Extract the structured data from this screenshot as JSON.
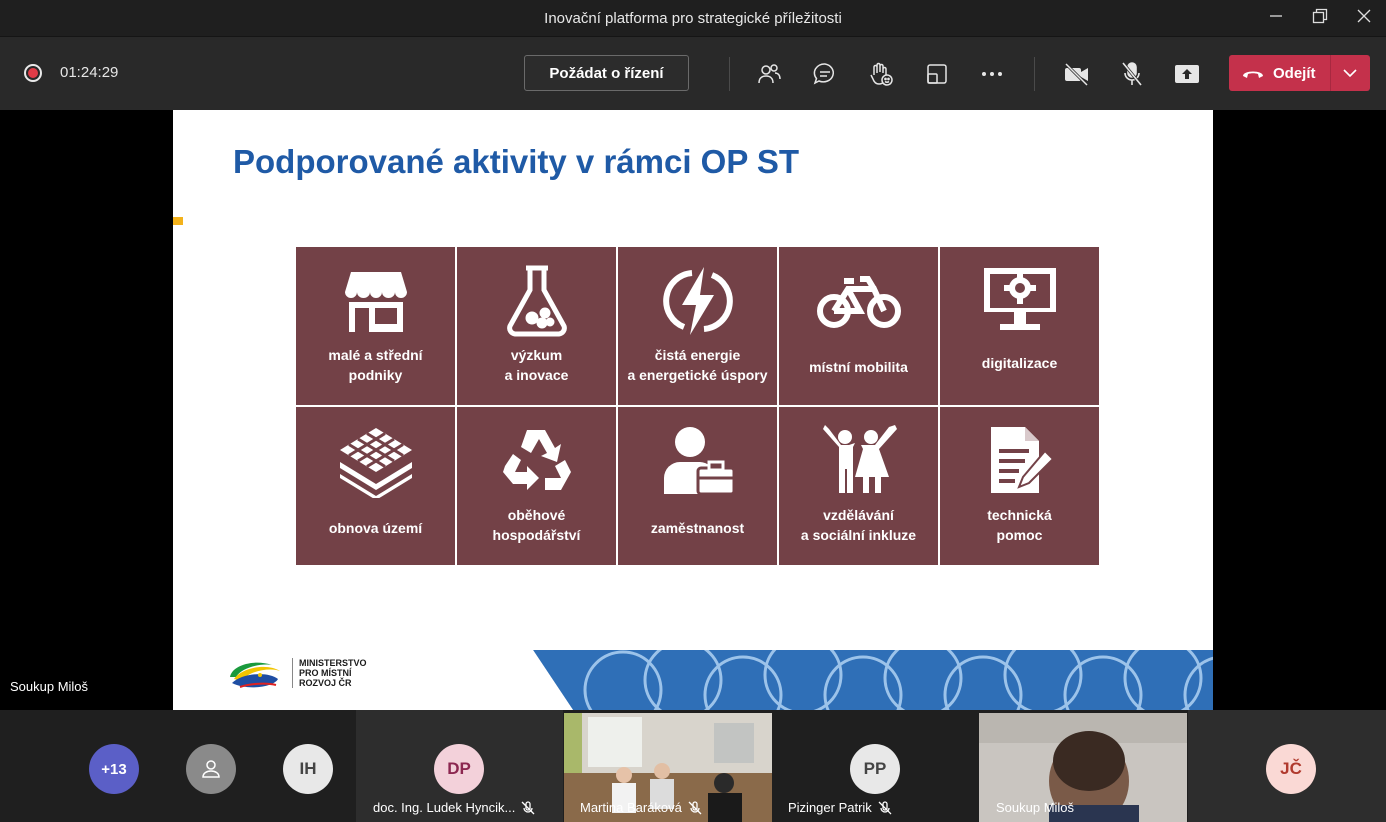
{
  "window": {
    "title": "Inovační platforma pro strategické příležitosti"
  },
  "toolbar": {
    "timer": "01:24:29",
    "request_control_label": "Požádat o řízení",
    "leave_label": "Odejít",
    "icons": [
      "participants-icon",
      "chat-icon",
      "raise-hand-icon",
      "rooms-icon",
      "more-icon",
      "camera-off-icon",
      "mic-off-icon",
      "share-icon"
    ]
  },
  "slide": {
    "title": "Podporované aktivity v rámci OP ST",
    "tiles": [
      {
        "label": "malé a střední\npodniky",
        "icon": "shop-icon"
      },
      {
        "label": "výzkum\na inovace",
        "icon": "flask-icon"
      },
      {
        "label": "čistá energie\na energetické úspory",
        "icon": "energy-icon"
      },
      {
        "label": "místní mobilita",
        "icon": "bicycle-icon"
      },
      {
        "label": "digitalizace",
        "icon": "monitor-gear-icon"
      },
      {
        "label": "obnova území",
        "icon": "layers-icon"
      },
      {
        "label": "oběhové\nhospodářství",
        "icon": "recycle-icon"
      },
      {
        "label": "zaměstnanost",
        "icon": "worker-briefcase-icon"
      },
      {
        "label": "vzdělávání\na sociální inkluze",
        "icon": "people-cheering-icon"
      },
      {
        "label": "technická\npomoc",
        "icon": "document-pen-icon"
      }
    ],
    "logo_text": "MINISTERSTVO\nPRO MÍSTNÍ\nROZVOJ ČR"
  },
  "speaker_name": "Soukup Miloš",
  "participants": {
    "overflow": "+13",
    "ih": "IH",
    "dp_initials": "DP",
    "dp_name": "doc. Ing. Ludek Hyncik...",
    "video1_name": "Martina Baráková",
    "pp_initials": "PP",
    "pp_name": "Pizinger Patrik",
    "video2_name": "Soukup Miloš",
    "jc": "JČ"
  },
  "colors": {
    "accent_red": "#c4314b",
    "tile": "#734147",
    "title_blue": "#1f5aa6"
  }
}
